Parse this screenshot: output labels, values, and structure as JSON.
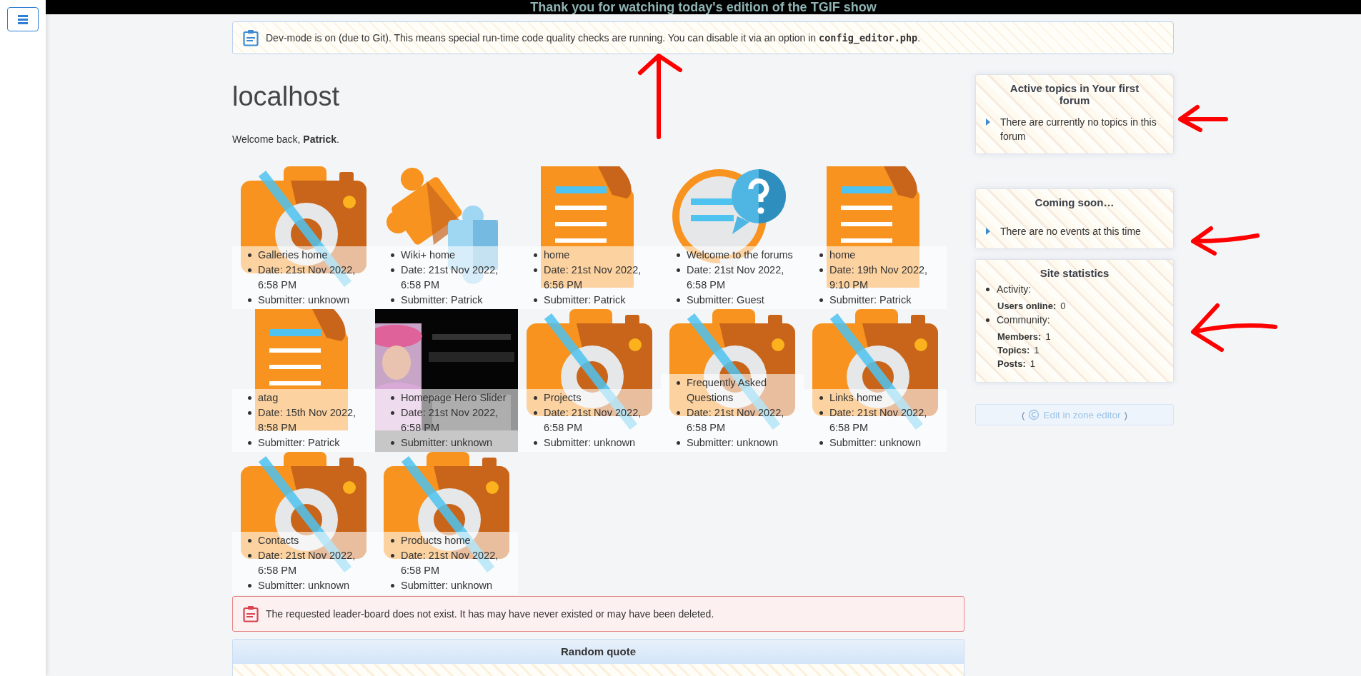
{
  "top_banner": {
    "text": "Thank you for watching today's edition of the TGIF show"
  },
  "dev_notice": {
    "text": "Dev-mode is on (due to Git). This means special run-time code quality checks are running. You can disable it via an option in **config_editor.php**."
  },
  "page_title": "localhost",
  "welcome": "Welcome back, **Patrick**.",
  "tiles": [
    {
      "kind": "camera",
      "title": "Galleries home",
      "date": "Date: 21st Nov 2022, 6:58 PM",
      "submitter": "Submitter: unknown"
    },
    {
      "kind": "puzzle",
      "title": "Wiki+ home",
      "date": "Date: 21st Nov 2022, 6:58 PM",
      "submitter": "Submitter: Patrick"
    },
    {
      "kind": "document",
      "title": "home",
      "date": "Date: 21st Nov 2022, 6:56 PM",
      "submitter": "Submitter: Patrick"
    },
    {
      "kind": "forum",
      "title": "Welcome to the forums",
      "date": "Date: 21st Nov 2022, 6:58 PM",
      "submitter": "Submitter: Guest"
    },
    {
      "kind": "document",
      "title": "home",
      "date": "Date: 19th Nov 2022, 9:10 PM",
      "submitter": "Submitter: Patrick"
    },
    {
      "kind": "document",
      "title": "atag",
      "date": "Date: 15th Nov 2022, 8:58 PM",
      "submitter": "Submitter: Patrick"
    },
    {
      "kind": "picture",
      "title": "Homepage Hero Slider",
      "date": "Date: 21st Nov 2022, 6:58 PM",
      "submitter": "Submitter: unknown"
    },
    {
      "kind": "camera",
      "title": "Projects",
      "date": "Date: 21st Nov 2022, 6:58 PM",
      "submitter": "Submitter: unknown"
    },
    {
      "kind": "camera",
      "title": "Frequently Asked Questions",
      "date": "Date: 21st Nov 2022, 6:58 PM",
      "submitter": "Submitter: unknown"
    },
    {
      "kind": "camera",
      "title": "Links home",
      "date": "Date: 21st Nov 2022, 6:58 PM",
      "submitter": "Submitter: unknown"
    },
    {
      "kind": "camera",
      "title": "Contacts",
      "date": "Date: 21st Nov 2022, 6:58 PM",
      "submitter": "Submitter: unknown"
    },
    {
      "kind": "camera",
      "title": "Products home",
      "date": "Date: 21st Nov 2022, 6:58 PM",
      "submitter": "Submitter: unknown"
    }
  ],
  "error_notice": {
    "text": "The requested leader-board does not exist. It has may have never existed or may have been deleted."
  },
  "random_quote": {
    "title": "Random quote"
  },
  "sidebar": [
    {
      "kind": "notice",
      "title": "Active topics in Your first forum",
      "message": "There are currently no topics in this forum"
    },
    {
      "kind": "notice",
      "title": "Coming soon…",
      "message": "There are no events at this time"
    },
    {
      "kind": "stats",
      "title": "Site statistics",
      "groups": [
        {
          "label": "Activity:",
          "rows": [
            {
              "label": "Users online:",
              "value": "0"
            }
          ]
        },
        {
          "label": "Community:",
          "rows": [
            {
              "label": "Members:",
              "value": "1"
            },
            {
              "label": "Topics:",
              "value": "1"
            },
            {
              "label": "Posts:",
              "value": "1"
            }
          ]
        }
      ]
    }
  ],
  "edit_link": {
    "open": "(",
    "label": "Edit in zone editor",
    "close": ")"
  }
}
